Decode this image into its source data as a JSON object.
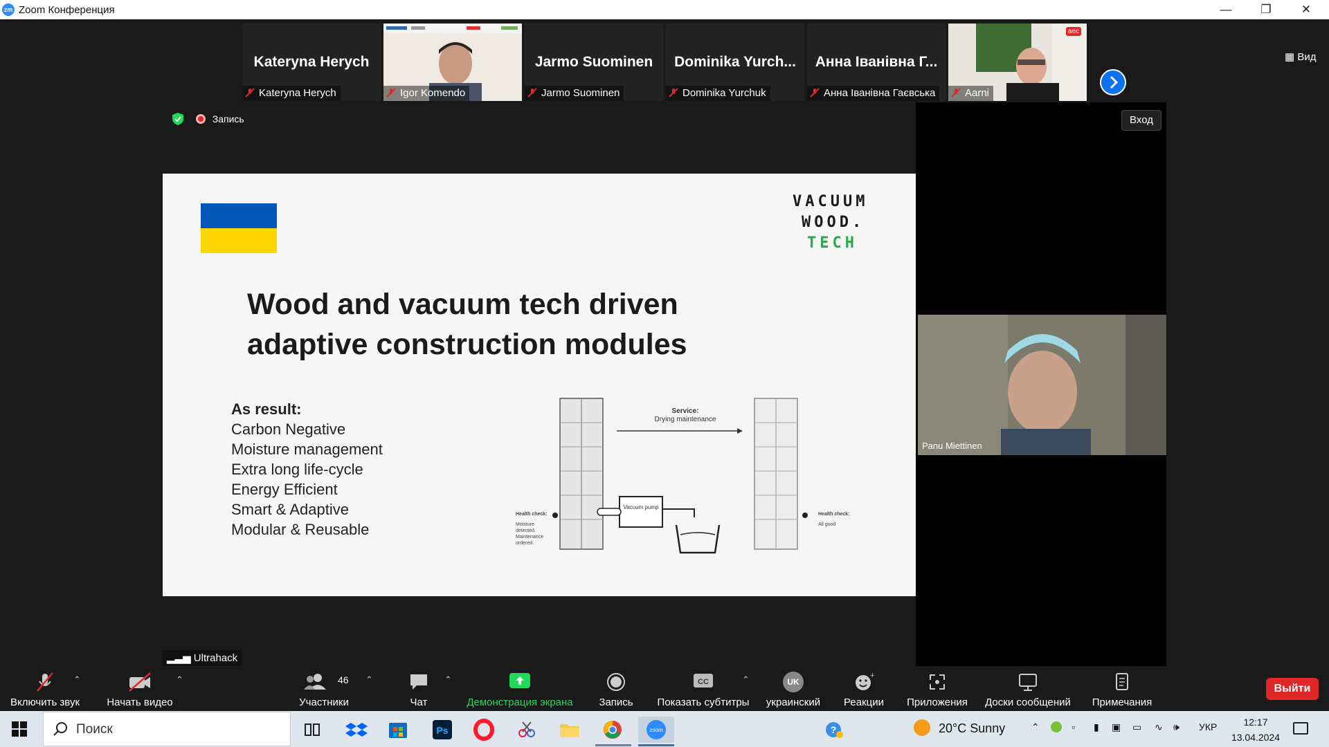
{
  "window": {
    "title": "Zoom Конференция",
    "app_icon_text": "zm"
  },
  "participants": [
    {
      "display": "Kateryna Herych",
      "name": "Kateryna Herych",
      "video": false
    },
    {
      "display": "",
      "name": "Igor Komendo",
      "video": true
    },
    {
      "display": "Jarmo Suominen",
      "name": "Jarmo Suominen",
      "video": false
    },
    {
      "display": "Dominika Yurch...",
      "name": "Dominika Yurchuk",
      "video": false
    },
    {
      "display": "Анна Іванівна Г...",
      "name": "Анна Іванівна Гаєвська",
      "video": false
    },
    {
      "display": "",
      "name": "Aarni",
      "video": true,
      "badge": "aec"
    }
  ],
  "view_button": "Вид",
  "recording": {
    "label": "Запись"
  },
  "login_button": "Вход",
  "speaker": {
    "name": "Panu Miettinen"
  },
  "slide": {
    "title_line1": "Wood and vacuum tech driven",
    "title_line2": "adaptive construction modules",
    "logo": [
      "VACUUM",
      "WOOD.",
      "TECH"
    ],
    "result_heading": "As result:",
    "results": [
      "Carbon Negative",
      "Moisture management",
      "Extra long life-cycle",
      "Energy Efficient",
      "Smart & Adaptive",
      "Modular & Reusable"
    ],
    "diagram": {
      "service_title": "Service:",
      "service_sub": "Drying maintenance",
      "pump": "Vacuum pump",
      "left_label": "Health check:",
      "left_sub": "Moisture detected. Maintenance ordered.",
      "right_label": "Health check:",
      "right_sub": "All good"
    }
  },
  "share_name": "Ultrahack",
  "toolbar": {
    "mute": "Включить звук",
    "video": "Начать видео",
    "participants": "Участники",
    "participants_count": "46",
    "chat": "Чат",
    "share": "Демонстрация экрана",
    "record": "Запись",
    "captions": "Показать субтитры",
    "language": "украинский",
    "language_badge": "UK",
    "reactions": "Реакции",
    "apps": "Приложения",
    "whiteboards": "Доски сообщений",
    "notes": "Примечания",
    "leave": "Выйти"
  },
  "taskbar": {
    "search_placeholder": "Поиск",
    "weather": "20°C  Sunny",
    "lang": "УКР",
    "time": "12:17",
    "date": "13.04.2024"
  },
  "colors": {
    "accent": "#0e72ed",
    "share_green": "#23d959",
    "leave_red": "#e02828",
    "ua_blue": "#0057b7",
    "ua_yellow": "#ffd700",
    "tech_green": "#2aa84a"
  }
}
